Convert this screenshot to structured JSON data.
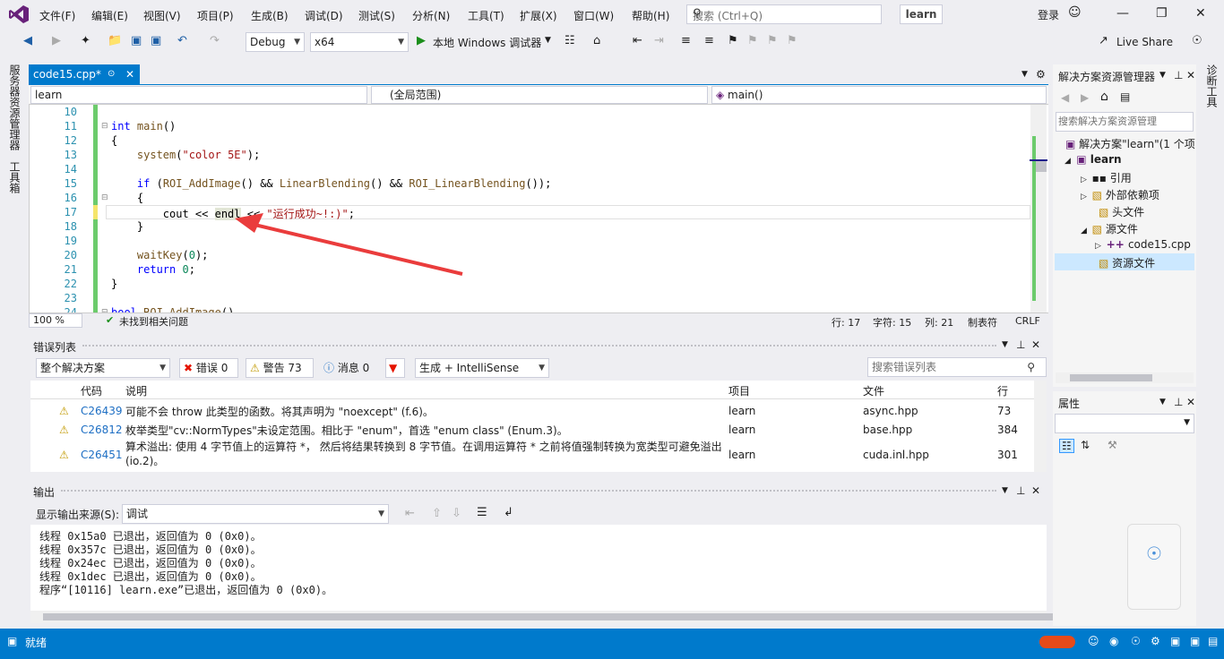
{
  "menubar": {
    "items": [
      "文件(F)",
      "编辑(E)",
      "视图(V)",
      "项目(P)",
      "生成(B)",
      "调试(D)",
      "测试(S)",
      "分析(N)",
      "工具(T)",
      "扩展(X)",
      "窗口(W)",
      "帮助(H)"
    ],
    "search_placeholder": "搜索 (Ctrl+Q)",
    "project": "learn",
    "signin": "登录"
  },
  "toolbar": {
    "config": "Debug",
    "platform": "x64",
    "run_label": "本地 Windows 调试器",
    "live_share": "Live Share"
  },
  "left_strip": {
    "server_explorer": "服务器资源管理器",
    "toolbox": "工具箱"
  },
  "right_strip": {
    "diag": "诊断工具"
  },
  "editor": {
    "tab_label": "code15.cpp*",
    "nav_project": "learn",
    "nav_scope": "(全局范围)",
    "nav_member": "main()",
    "lines": [
      {
        "n": "10",
        "t": ""
      },
      {
        "n": "11",
        "t": "int main()"
      },
      {
        "n": "12",
        "t": "{"
      },
      {
        "n": "13",
        "t": "    system(\"color 5E\");"
      },
      {
        "n": "14",
        "t": ""
      },
      {
        "n": "15",
        "t": "    if (ROI_AddImage() && LinearBlending() && ROI_LinearBlending());"
      },
      {
        "n": "16",
        "t": "    {"
      },
      {
        "n": "17",
        "t": "        cout << endl << \"运行成功~!:)\";"
      },
      {
        "n": "18",
        "t": "    }"
      },
      {
        "n": "19",
        "t": ""
      },
      {
        "n": "20",
        "t": "    waitKey(0);"
      },
      {
        "n": "21",
        "t": "    return 0;"
      },
      {
        "n": "22",
        "t": "}"
      },
      {
        "n": "23",
        "t": ""
      },
      {
        "n": "24",
        "t": "bool ROI_AddImage()"
      }
    ],
    "zoom": "100 %",
    "no_issues": "未找到相关问题",
    "row": "行: 17",
    "char": "字符: 15",
    "col": "列: 21",
    "tabs": "制表符",
    "eol": "CRLF"
  },
  "error_list": {
    "title": "错误列表",
    "scope": "整个解决方案",
    "errors": "错误 0",
    "warnings": "警告 73",
    "messages": "消息 0",
    "build_filter": "生成 + IntelliSense",
    "search_placeholder": "搜索错误列表",
    "columns": [
      "代码",
      "说明",
      "项目",
      "文件",
      "行"
    ],
    "rows": [
      {
        "code": "C26439",
        "desc": "可能不会 throw 此类型的函数。将其声明为 \"noexcept\" (f.6)。",
        "project": "learn",
        "file": "async.hpp",
        "line": "73"
      },
      {
        "code": "C26812",
        "desc": "枚举类型\"cv::NormTypes\"未设定范围。相比于 \"enum\"，首选 \"enum class\" (Enum.3)。",
        "project": "learn",
        "file": "base.hpp",
        "line": "384"
      },
      {
        "code": "C26451",
        "desc": "算术溢出: 使用 4 字节值上的运算符 *， 然后将结果转换到 8 字节值。在调用运算符 * 之前将值强制转换为宽类型可避免溢出 (io.2)。",
        "project": "learn",
        "file": "cuda.inl.hpp",
        "line": "301"
      }
    ]
  },
  "output": {
    "title": "输出",
    "source_label": "显示输出来源(S):",
    "source_value": "调试",
    "lines": [
      "线程 0x15a0 已退出，返回值为 0 (0x0)。",
      "线程 0x357c 已退出，返回值为 0 (0x0)。",
      "线程 0x24ec 已退出，返回值为 0 (0x0)。",
      "线程 0x1dec 已退出，返回值为 0 (0x0)。",
      "程序“[10116] learn.exe”已退出，返回值为 0 (0x0)。"
    ]
  },
  "solution_explorer": {
    "title": "解决方案资源管理器",
    "search_placeholder": "搜索解决方案资源管理",
    "solution": "解决方案\"learn\"(1 个项",
    "project": "learn",
    "references": "引用",
    "external": "外部依赖项",
    "headers": "头文件",
    "sources": "源文件",
    "file": "code15.cpp",
    "resources": "资源文件"
  },
  "properties": {
    "title": "属性"
  },
  "statusbar": {
    "text": "就绪"
  },
  "colors": {
    "accent": "#007acc",
    "warning": "#f5c400",
    "error": "#e51400"
  }
}
